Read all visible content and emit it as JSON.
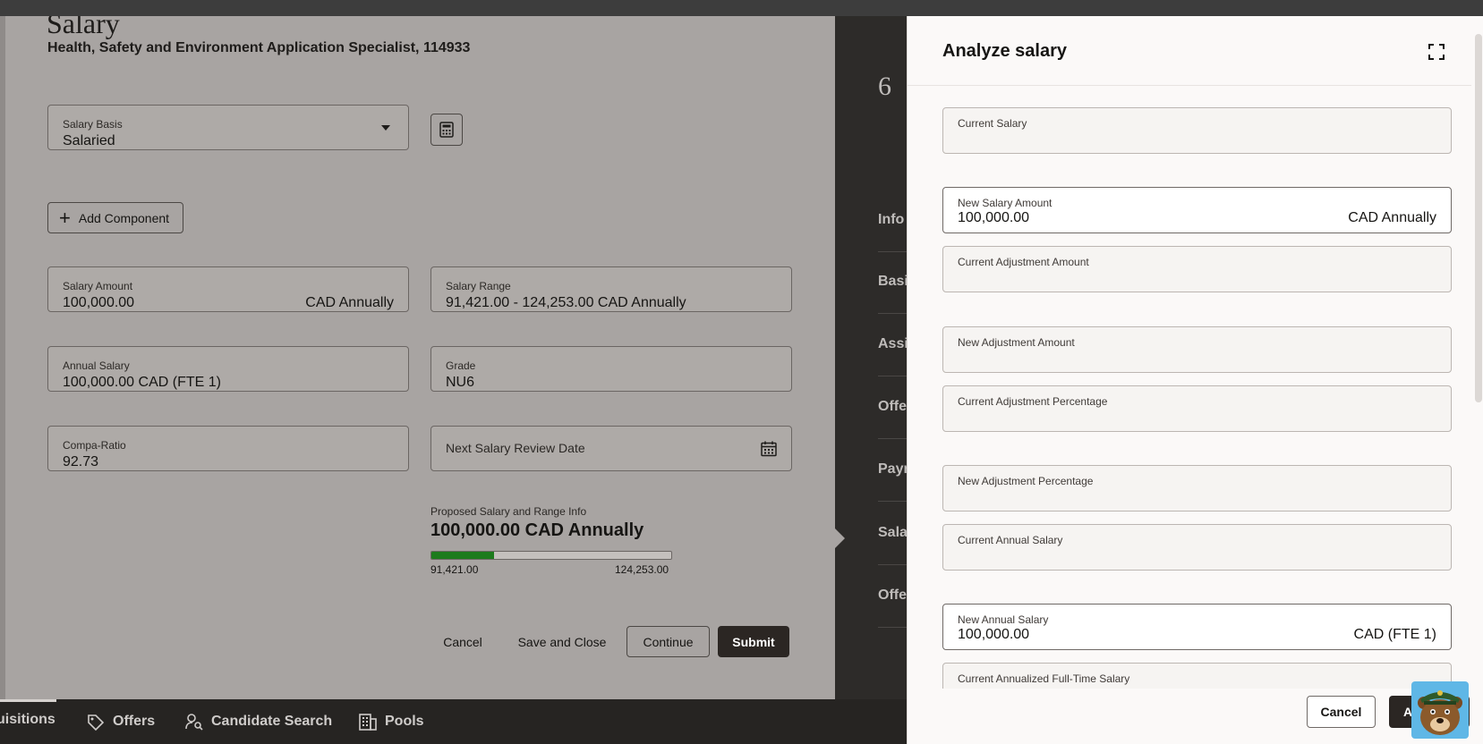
{
  "page": {
    "title": "Salary",
    "subtitle": "Health, Safety and Environment Application Specialist, 114933"
  },
  "form": {
    "salary_basis": {
      "label": "Salary Basis",
      "value": "Salaried"
    },
    "add_component_label": "Add Component",
    "salary_amount": {
      "label": "Salary Amount",
      "value": "100,000.00",
      "unit": "CAD Annually"
    },
    "salary_range": {
      "label": "Salary Range",
      "value": "91,421.00 - 124,253.00 CAD Annually"
    },
    "annual_salary": {
      "label": "Annual Salary",
      "value": "100,000.00 CAD (FTE 1)"
    },
    "grade": {
      "label": "Grade",
      "value": "NU6"
    },
    "compa_ratio": {
      "label": "Compa-Ratio",
      "value": "92.73"
    },
    "next_review": {
      "label": "Next Salary Review Date"
    }
  },
  "proposed": {
    "label": "Proposed Salary and Range Info",
    "value": "100,000.00 CAD Annually",
    "range_min": "91,421.00",
    "range_max": "124,253.00",
    "position_fraction": 0.26,
    "fill_color": "#1d7b1d"
  },
  "actions": {
    "cancel": "Cancel",
    "save_close": "Save and Close",
    "continue": "Continue",
    "submit": "Submit"
  },
  "train": {
    "step_number": "6",
    "items": [
      "Info",
      "Basic",
      "Assi",
      "Offe",
      "Payr",
      "Sala",
      "Offe"
    ]
  },
  "bottom_nav": {
    "items": [
      "uisitions",
      "Offers",
      "Candidate Search",
      "Pools"
    ]
  },
  "drawer": {
    "title": "Analyze salary",
    "fields": [
      {
        "label": "Current Salary",
        "value": "",
        "unit": ""
      },
      {
        "label": "New Salary Amount",
        "value": "100,000.00",
        "unit": "CAD Annually"
      },
      {
        "label": "Current Adjustment Amount",
        "value": "",
        "unit": ""
      },
      {
        "label": "New Adjustment Amount",
        "value": "",
        "unit": ""
      },
      {
        "label": "Current Adjustment Percentage",
        "value": "",
        "unit": ""
      },
      {
        "label": "New Adjustment Percentage",
        "value": "",
        "unit": ""
      },
      {
        "label": "Current Annual Salary",
        "value": "",
        "unit": ""
      },
      {
        "label": "New Annual Salary",
        "value": "100,000.00",
        "unit": "CAD (FTE 1)"
      },
      {
        "label": "Current Annualized Full-Time Salary",
        "value": "",
        "unit": ""
      }
    ],
    "cancel_label": "Cancel",
    "apply_label": "A"
  }
}
